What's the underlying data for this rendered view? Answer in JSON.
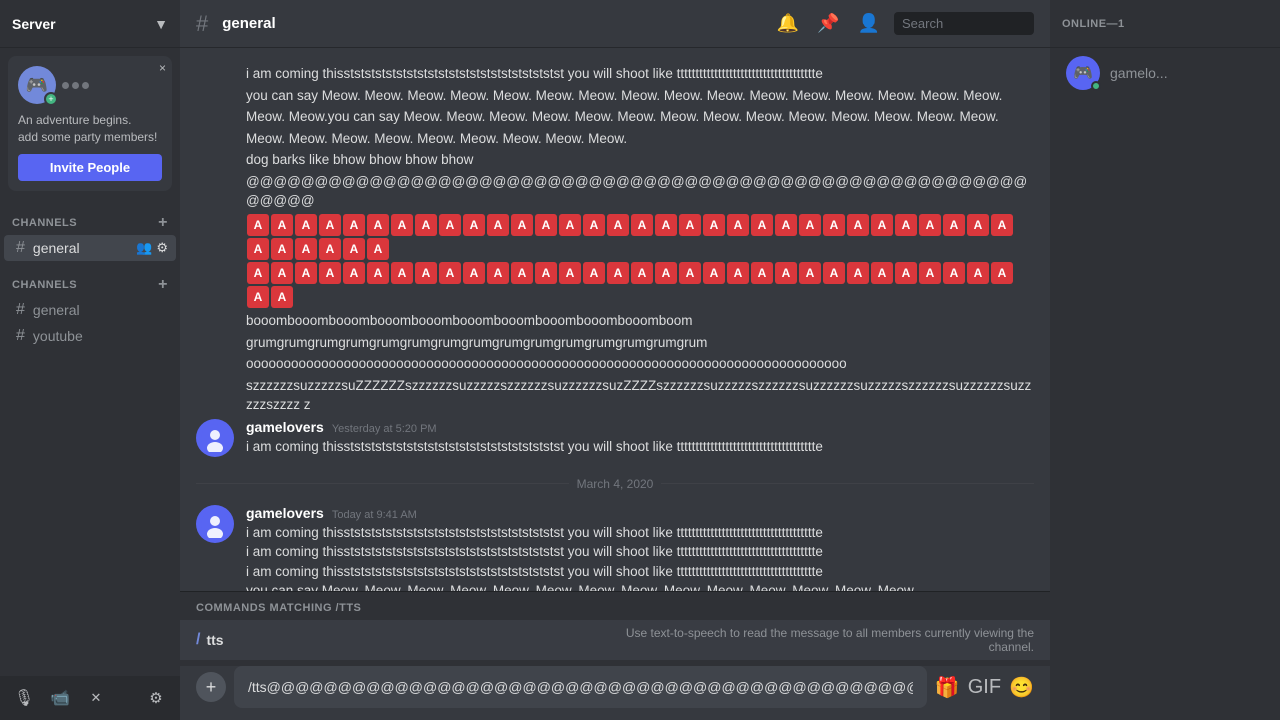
{
  "sidebar": {
    "server_name": "Server",
    "chevron": "▼",
    "party": {
      "close_label": "×",
      "title": "An adventure begins.",
      "subtitle": "add some party members!",
      "invite_label": "Invite People"
    },
    "channels_header": "CHANNELS",
    "channels_add": "+",
    "channels": [
      {
        "name": "general",
        "active": true
      },
      {
        "name": "general",
        "active": false
      },
      {
        "name": "youtube",
        "active": false
      }
    ],
    "voice_channels_header": "CHANNELS",
    "voice_add": "+"
  },
  "topbar": {
    "channel_name": "general",
    "search_placeholder": "Search"
  },
  "messages": [
    {
      "id": "msg1",
      "continued": true,
      "lines": [
        "i am coming thisststststststststststststststststststststst you will shoot like ttttttttttttttttttttttttttttttttttttte",
        "you can say Meow. Meow. Meow. Meow. Meow. Meow. Meow. Meow. Meow. Meow. Meow. Meow. Meow. Meow. Meow. Meow.",
        "Meow. Meow.you can say Meow. Meow. Meow. Meow. Meow. Meow. Meow. Meow. Meow. Meow. Meow. Meow. Meow. Meow.",
        "Meow. Meow. Meow. Meow. Meow. Meow. Meow. Meow. Meow.",
        "dog barks like bhow bhow bhow bhow",
        "@@@@@@@@@@@@@@@@@@@@@@@@@@@@@@@@@@@@@@@@@@@@@@@@@@@@@@@@@@@@@@",
        "EMOJI_A_ROW",
        "booombooombooombooombooombooombooombooombooombooomboom",
        "grumgrumgrumgrumgrumgrumgrumgrumgrumgrumgrumgrumgrumgrumgrum",
        "oooooooooooooooooooooooooooooooooooooooooooooooooooooooooooooooooooooooooooooooo",
        "szzzzzzsuzzzzzsuZZZZZZszzzzzzsuzzzzzszzzzzzsuzzzzzzsuzZZZZszzzzzzsuzzzzzszzzzzzsuzzzzzzsuzzzzzszzzzzzsuzzzzzzsuzzzzzszzzz z"
      ]
    },
    {
      "id": "msg2",
      "author": "gamelovers",
      "timestamp": "Yesterday at 5:20 PM",
      "lines": [
        "i am coming thisststststststststststststststststststststst you will shoot like ttttttttttttttttttttttttttttttttttttte"
      ]
    },
    {
      "id": "date_divider",
      "type": "divider",
      "label": "March 4, 2020"
    },
    {
      "id": "msg3",
      "author": "gamelovers",
      "timestamp": "Today at 9:41 AM",
      "lines": [
        "i am coming thisststststststststststststststststststststst you will shoot like ttttttttttttttttttttttttttttttttttttte",
        "i am coming thisststststststststststststststststststststst you will shoot like ttttttttttttttttttttttttttttttttttttte",
        "i am coming thisststststststststststststststststststststst you will shoot like ttttttttttttttttttttttttttttttttttttte",
        "you can say Meow. Meow. Meow. Meow. Meow. Meow. Meow. Meow. Meow. Meow. Meow. Meow. Meow. Meow."
      ]
    }
  ],
  "commands": {
    "label": "COMMANDS MATCHING /tts",
    "items": [
      {
        "slash": "/",
        "name": "tts",
        "desc": "Use text-to-speech to read the message to all members currently viewing the channel."
      }
    ]
  },
  "input": {
    "value": "/tts@@@@@@@@@@@@@@@@@@@@@@@@@@@@@@@@@@@@@@@@@@@@@@@@@@@@@@@@@@@@@@@@@@@@@@",
    "plus_label": "+"
  },
  "right_sidebar": {
    "online_label": "ONLINE—1",
    "members": [
      {
        "name": "gamelo..."
      }
    ]
  },
  "emoji_a_count": 38
}
